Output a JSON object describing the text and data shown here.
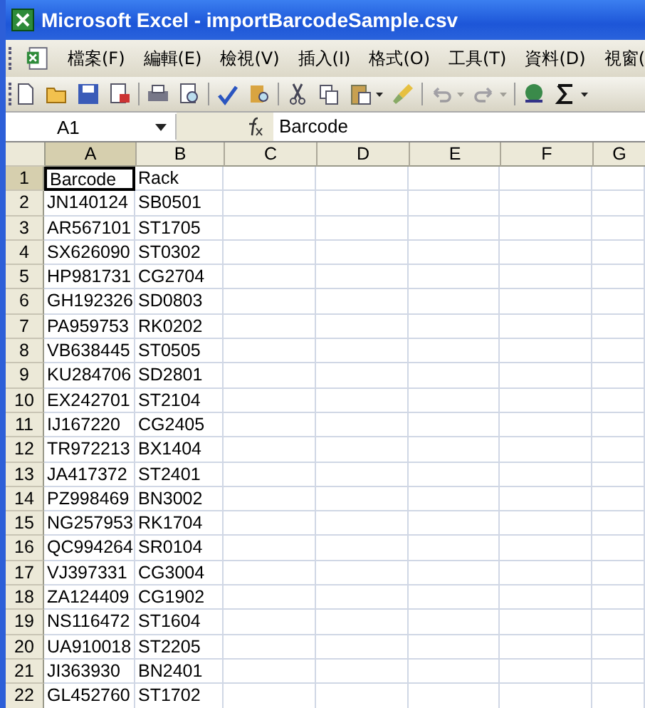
{
  "window": {
    "title": "Microsoft Excel - importBarcodeSample.csv"
  },
  "menu": [
    "檔案(F)",
    "編輯(E)",
    "檢視(V)",
    "插入(I)",
    "格式(O)",
    "工具(T)",
    "資料(D)",
    "視窗("
  ],
  "toolbar": [
    {
      "kind": "new",
      "disabled": false
    },
    {
      "kind": "open",
      "disabled": false
    },
    {
      "kind": "save",
      "disabled": false
    },
    {
      "kind": "permission",
      "disabled": false
    },
    {
      "kind": "sep"
    },
    {
      "kind": "print",
      "disabled": false
    },
    {
      "kind": "preview",
      "disabled": false
    },
    {
      "kind": "sep"
    },
    {
      "kind": "spelling",
      "disabled": false
    },
    {
      "kind": "research",
      "disabled": false
    },
    {
      "kind": "sep"
    },
    {
      "kind": "cut",
      "disabled": false
    },
    {
      "kind": "copy",
      "disabled": false
    },
    {
      "kind": "paste",
      "disabled": false
    },
    {
      "kind": "dropdown",
      "disabled": false
    },
    {
      "kind": "painter",
      "disabled": false
    },
    {
      "kind": "sep"
    },
    {
      "kind": "undo",
      "disabled": true
    },
    {
      "kind": "dropdown",
      "disabled": true
    },
    {
      "kind": "redo",
      "disabled": true
    },
    {
      "kind": "dropdown",
      "disabled": true
    },
    {
      "kind": "sep"
    },
    {
      "kind": "hyperlink",
      "disabled": false
    },
    {
      "kind": "sum",
      "disabled": false
    },
    {
      "kind": "dropdown",
      "disabled": false
    }
  ],
  "name_box": "A1",
  "formula": "Barcode",
  "columns": [
    {
      "label": "A",
      "selected": true
    },
    {
      "label": "B",
      "selected": false
    },
    {
      "label": "C",
      "selected": false
    },
    {
      "label": "D",
      "selected": false
    },
    {
      "label": "E",
      "selected": false
    },
    {
      "label": "F",
      "selected": false
    },
    {
      "label": "G",
      "selected": false
    }
  ],
  "rows": [
    {
      "number": "1",
      "selected": true,
      "cells": [
        "Barcode",
        "Rack"
      ]
    },
    {
      "number": "2",
      "selected": false,
      "cells": [
        "JN140124",
        "SB0501"
      ]
    },
    {
      "number": "3",
      "selected": false,
      "cells": [
        "AR567101",
        "ST1705"
      ]
    },
    {
      "number": "4",
      "selected": false,
      "cells": [
        "SX626090",
        "ST0302"
      ]
    },
    {
      "number": "5",
      "selected": false,
      "cells": [
        "HP981731",
        "CG2704"
      ]
    },
    {
      "number": "6",
      "selected": false,
      "cells": [
        "GH192326",
        "SD0803"
      ]
    },
    {
      "number": "7",
      "selected": false,
      "cells": [
        "PA959753",
        "RK0202"
      ]
    },
    {
      "number": "8",
      "selected": false,
      "cells": [
        "VB638445",
        "ST0505"
      ]
    },
    {
      "number": "9",
      "selected": false,
      "cells": [
        "KU284706",
        "SD2801"
      ]
    },
    {
      "number": "10",
      "selected": false,
      "cells": [
        "EX242701",
        "ST2104"
      ]
    },
    {
      "number": "11",
      "selected": false,
      "cells": [
        "IJ167220",
        "CG2405"
      ]
    },
    {
      "number": "12",
      "selected": false,
      "cells": [
        "TR972213",
        "BX1404"
      ]
    },
    {
      "number": "13",
      "selected": false,
      "cells": [
        "JA417372",
        "ST2401"
      ]
    },
    {
      "number": "14",
      "selected": false,
      "cells": [
        "PZ998469",
        "BN3002"
      ]
    },
    {
      "number": "15",
      "selected": false,
      "cells": [
        "NG257953",
        "RK1704"
      ]
    },
    {
      "number": "16",
      "selected": false,
      "cells": [
        "QC994264",
        "SR0104"
      ]
    },
    {
      "number": "17",
      "selected": false,
      "cells": [
        "VJ397331",
        "CG3004"
      ]
    },
    {
      "number": "18",
      "selected": false,
      "cells": [
        "ZA124409",
        "CG1902"
      ]
    },
    {
      "number": "19",
      "selected": false,
      "cells": [
        "NS116472",
        "ST1604"
      ]
    },
    {
      "number": "20",
      "selected": false,
      "cells": [
        "UA910018",
        "ST2205"
      ]
    },
    {
      "number": "21",
      "selected": false,
      "cells": [
        "JI363930",
        "BN2401"
      ]
    },
    {
      "number": "22",
      "selected": false,
      "cells": [
        "GL452760",
        "ST1702"
      ]
    }
  ]
}
